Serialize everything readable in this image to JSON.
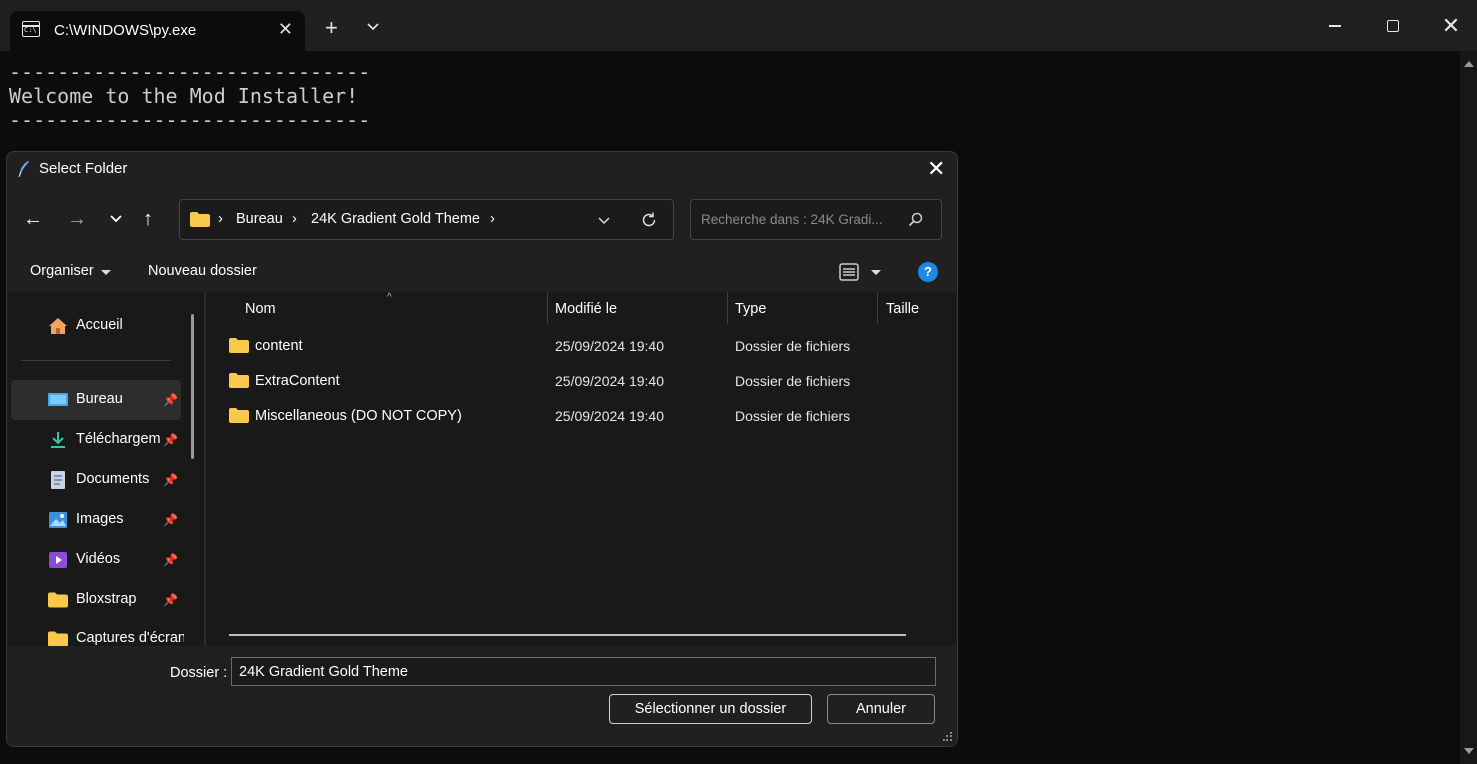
{
  "terminal": {
    "tab_title": "C:\\WINDOWS\\py.exe",
    "lines": [
      "------------------------------",
      "Welcome to the Mod Installer!",
      "------------------------------"
    ]
  },
  "dialog": {
    "title": "Select Folder",
    "breadcrumbs": [
      "Bureau",
      "24K Gradient Gold Theme"
    ],
    "search_placeholder": "Recherche dans : 24K Gradi...",
    "toolbar": {
      "organise": "Organiser",
      "new_folder": "Nouveau dossier"
    },
    "sidebar": {
      "items": [
        {
          "label": "Accueil",
          "icon": "home-icon",
          "pinned": false
        },
        {
          "label": "Bureau",
          "icon": "desktop-icon",
          "pinned": true
        },
        {
          "label": "Téléchargem",
          "icon": "download-icon",
          "pinned": true
        },
        {
          "label": "Documents",
          "icon": "documents-icon",
          "pinned": true
        },
        {
          "label": "Images",
          "icon": "images-icon",
          "pinned": true
        },
        {
          "label": "Vidéos",
          "icon": "videos-icon",
          "pinned": true
        },
        {
          "label": "Bloxstrap",
          "icon": "folder-icon",
          "pinned": true
        },
        {
          "label": "Captures d'écran",
          "icon": "folder-icon",
          "pinned": false
        }
      ]
    },
    "columns": [
      "Nom",
      "Modifié le",
      "Type",
      "Taille"
    ],
    "files": [
      {
        "name": "content",
        "modified": "25/09/2024 19:40",
        "type": "Dossier de fichiers"
      },
      {
        "name": "ExtraContent",
        "modified": "25/09/2024 19:40",
        "type": "Dossier de fichiers"
      },
      {
        "name": "Miscellaneous (DO NOT COPY)",
        "modified": "25/09/2024 19:40",
        "type": "Dossier de fichiers"
      }
    ],
    "folder_label": "Dossier :",
    "folder_value": "24K Gradient Gold Theme",
    "select_button": "Sélectionner un dossier",
    "cancel_button": "Annuler"
  },
  "colors": {
    "terminal_bg": "#0c0c0c",
    "dialog_bg": "#202020",
    "folder_yellow": "#f8c94a",
    "accent_blue": "#1e88e5"
  }
}
